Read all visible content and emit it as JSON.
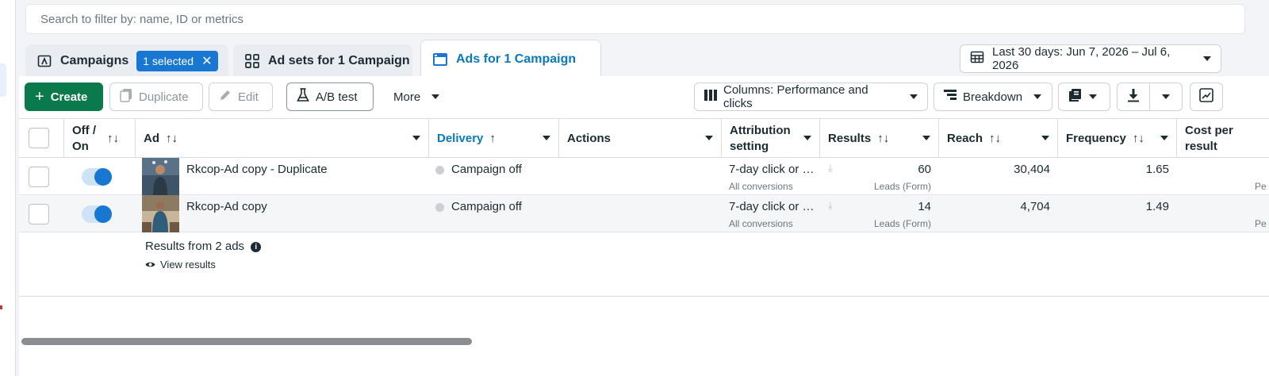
{
  "search": {
    "placeholder": "Search to filter by: name, ID or metrics"
  },
  "tabs": {
    "campaigns": {
      "label": "Campaigns",
      "badge": "1 selected",
      "badge_close": "✕"
    },
    "adsets": {
      "label": "Ad sets for 1 Campaign"
    },
    "ads": {
      "label": "Ads for 1 Campaign"
    }
  },
  "date_range": {
    "label": "Last 30 days: Jun 7, 2026 – Jul 6, 2026"
  },
  "toolbar": {
    "create": "Create",
    "duplicate": "Duplicate",
    "edit": "Edit",
    "ab_test": "A/B test",
    "more": "More",
    "columns": "Columns: Performance and clicks",
    "breakdown": "Breakdown"
  },
  "columns": {
    "off_on": [
      "Off /",
      "On"
    ],
    "ad": "Ad",
    "delivery": "Delivery",
    "actions": "Actions",
    "attribution": [
      "Attribution",
      "setting"
    ],
    "results": "Results",
    "reach": "Reach",
    "frequency": "Frequency",
    "cost_per_result": [
      "Cost per",
      "result"
    ]
  },
  "rows": [
    {
      "name": "Rkcop-Ad copy - Duplicate",
      "delivery": "Campaign off",
      "attribution": "7-day click or …",
      "attribution_sub": "All conversions",
      "results": "60",
      "results_sub": "Leads (Form)",
      "reach": "30,404",
      "frequency": "1.65",
      "cost_sub": "Pe"
    },
    {
      "name": "Rkcop-Ad copy",
      "delivery": "Campaign off",
      "attribution": "7-day click or …",
      "attribution_sub": "All conversions",
      "results": "14",
      "results_sub": "Leads (Form)",
      "reach": "4,704",
      "frequency": "1.49",
      "cost_sub": "Pe"
    }
  ],
  "summary": {
    "label": "Results from 2 ads",
    "view": "View results"
  },
  "colors": {
    "accent": "#1877d2",
    "create": "#0b7a4b",
    "link": "#0a78be"
  }
}
